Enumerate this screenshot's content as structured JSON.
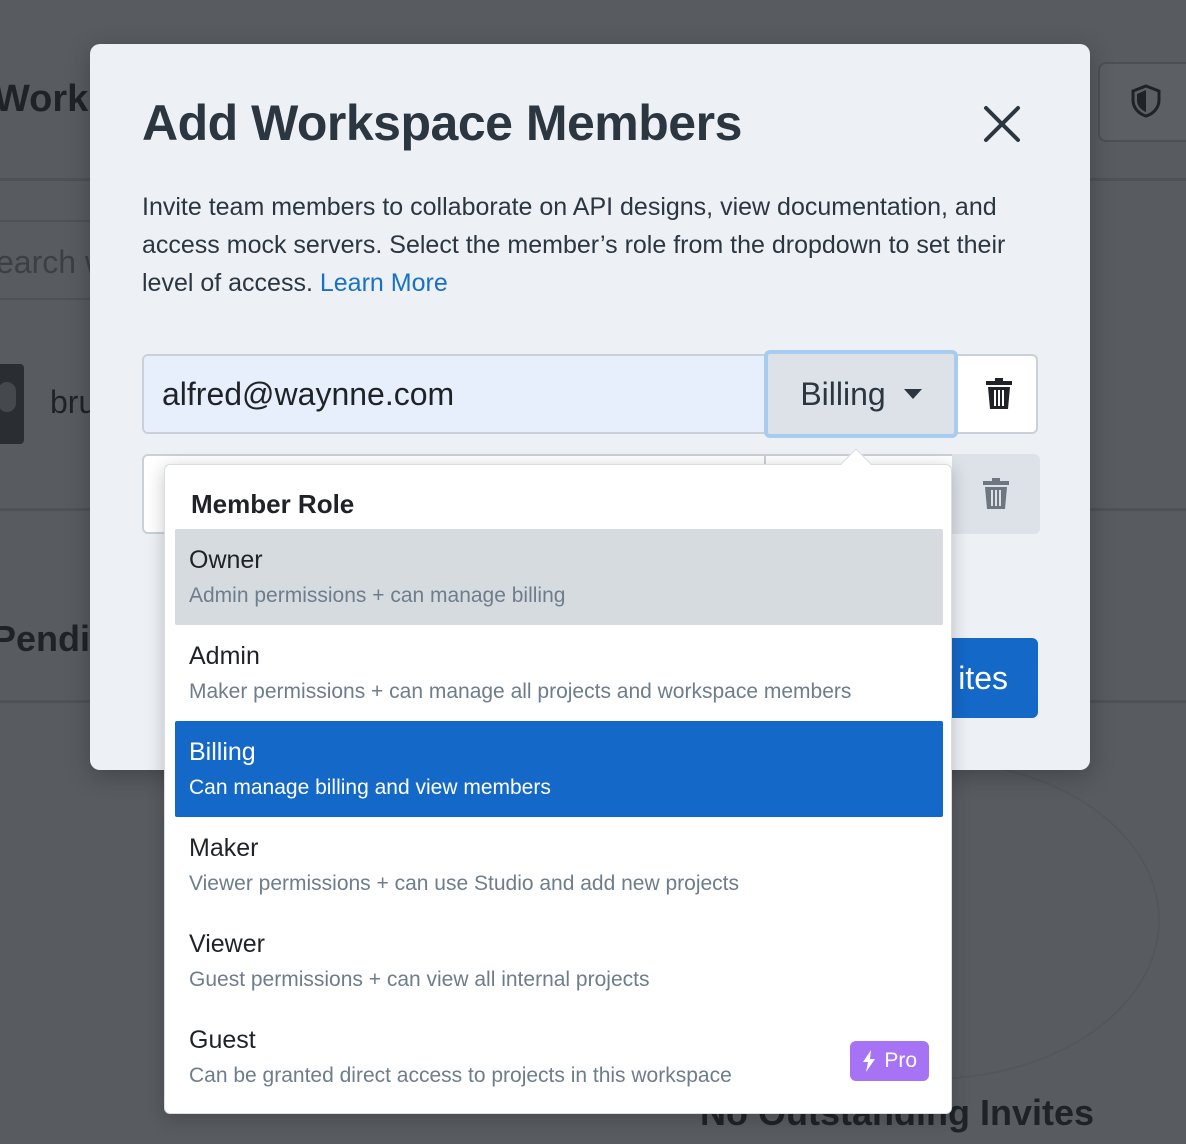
{
  "background": {
    "page_title": "Works",
    "search_placeholder": "earch w",
    "member_name": "bru",
    "pending_heading": "Pendin",
    "no_invites": "No Outstanding Invites"
  },
  "modal": {
    "title": "Add Workspace Members",
    "description": "Invite team members to collaborate on API designs, view documentation, and access mock servers. Select the member’s role from the dropdown to set their level of access.",
    "learn_more": "Learn More",
    "email_value": "alfred@waynne.com",
    "selected_role": "Billing",
    "send_label": "ites"
  },
  "dropdown": {
    "header": "Member Role",
    "options": [
      {
        "title": "Owner",
        "desc": "Admin permissions + can manage billing"
      },
      {
        "title": "Admin",
        "desc": "Maker permissions + can manage all projects and workspace members"
      },
      {
        "title": "Billing",
        "desc": "Can manage billing and view members"
      },
      {
        "title": "Maker",
        "desc": "Viewer permissions + can use Studio and add new projects"
      },
      {
        "title": "Viewer",
        "desc": "Guest permissions + can view all internal projects"
      },
      {
        "title": "Guest",
        "desc": "Can be granted direct access to projects in this workspace",
        "badge": "Pro"
      }
    ]
  },
  "colors": {
    "accent": "#1468c7",
    "pro_badge": "#a673f5",
    "hover": "#d6dbe0"
  },
  "icons": {
    "close": "close-icon",
    "trash": "trash-icon",
    "shield": "shield-icon",
    "bolt": "bolt-icon",
    "caret": "chevron-down-icon"
  }
}
